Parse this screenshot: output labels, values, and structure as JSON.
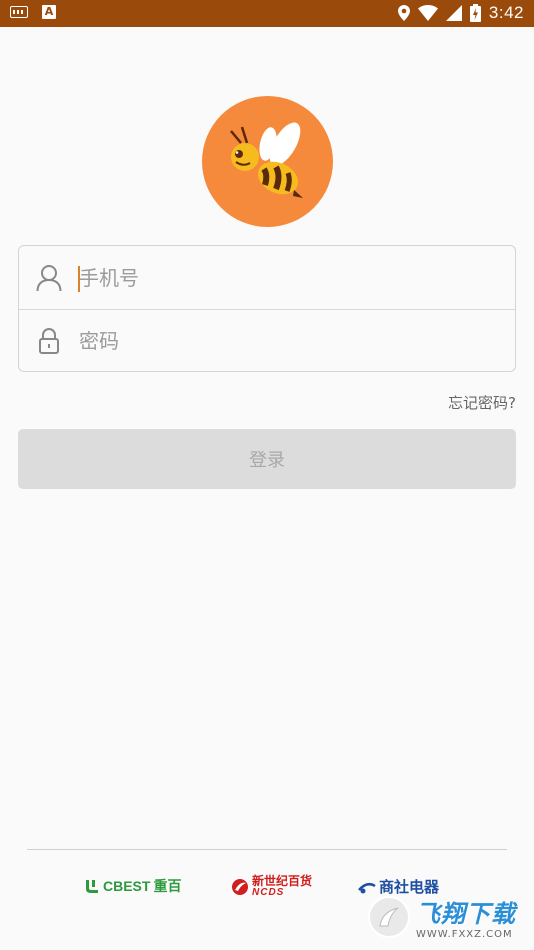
{
  "status_bar": {
    "time": "3:42",
    "notification_letter": "A",
    "icons": [
      "keyboard-icon",
      "a-notification-icon",
      "location-icon",
      "wifi-icon",
      "signal-icon",
      "battery-icon"
    ]
  },
  "colors": {
    "status_bar": "#9a4a0a",
    "logo_bg": "#f58a3c",
    "bee_yellow": "#f6bc1e",
    "bee_dark": "#5a2a0a",
    "caret": "#d9812f",
    "button_bg": "#dcdcdc"
  },
  "login_form": {
    "phone_placeholder": "手机号",
    "password_placeholder": "密码",
    "forgot_password": "忘记密码?",
    "login_button": "登录"
  },
  "footer": {
    "brands": [
      {
        "name": "CBEST",
        "chinese": "重百"
      },
      {
        "name": "NCDS",
        "chinese": "新世纪百货"
      },
      {
        "name": "",
        "chinese": "商社电器"
      }
    ],
    "watermark": {
      "title": "飞翔下载",
      "url": "WWW.FXXZ.COM"
    }
  }
}
